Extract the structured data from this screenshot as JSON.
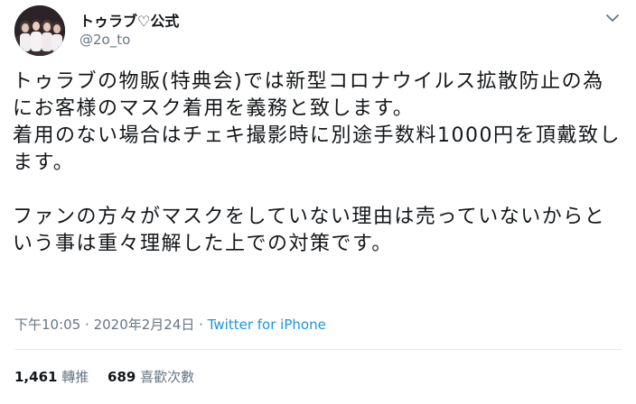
{
  "account": {
    "display_name": "トゥラブ♡公式",
    "handle": "@2o_to",
    "avatar_icon": "group-photo-avatar"
  },
  "tweet": {
    "text": "トゥラブの物販(特典会)では新型コロナウイルス拡散防止の為にお客様のマスク着用を義務と致します。\n着用のない場合はチェキ撮影時に別途手数料1000円を頂戴致します。\n\nファンの方々がマスクをしていない理由は売っていないからという事は重々理解した上での対策です。",
    "time": "下午10:05",
    "date": "2020年2月24日",
    "separator": "·",
    "source": "Twitter for iPhone"
  },
  "stats": {
    "retweets_count": "1,461",
    "retweets_label": "轉推",
    "likes_count": "689",
    "likes_label": "喜歡次數"
  },
  "colors": {
    "text": "#14171a",
    "secondary": "#657786",
    "link": "#1b95e0",
    "divider": "#e6ecf0"
  }
}
